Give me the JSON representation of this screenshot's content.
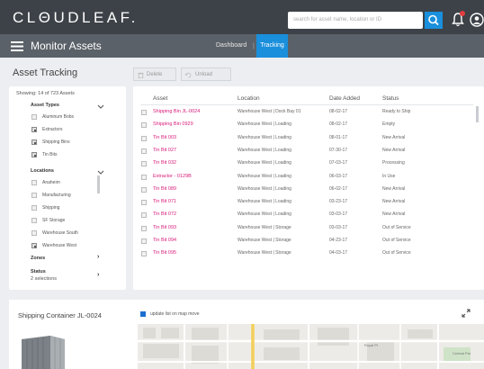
{
  "header": {
    "logo": "CLΘUDLEAF.",
    "search_placeholder": "search for asset name, location or ID"
  },
  "subheader": {
    "title": "Monitor Assets",
    "tabs": [
      {
        "label": "Dashboard",
        "active": false
      },
      {
        "label": "Tracking",
        "active": true
      }
    ],
    "separator": "|"
  },
  "page": {
    "title": "Asset Tracking",
    "delete_label": "Delete",
    "unload_label": "Unload"
  },
  "filters": {
    "showing": "Showing: 14 of 723 Assets",
    "asset_types": {
      "title": "Asset Types",
      "items": [
        {
          "label": "Aluminum Bobs",
          "checked": false
        },
        {
          "label": "Extractors",
          "checked": true
        },
        {
          "label": "Shipping Bins",
          "checked": true
        },
        {
          "label": "Tin Bits",
          "checked": true
        }
      ]
    },
    "locations": {
      "title": "Locations",
      "items": [
        {
          "label": "Anaheim",
          "checked": false
        },
        {
          "label": "Manufacturing",
          "checked": false
        },
        {
          "label": "Shipping",
          "checked": false
        },
        {
          "label": "SF Storage",
          "checked": false
        },
        {
          "label": "Warehouse South",
          "checked": false
        },
        {
          "label": "Warehouse West",
          "checked": true
        }
      ]
    },
    "zones": {
      "title": "Zones",
      "chevron": "›"
    },
    "status": {
      "title": "Status",
      "subtitle": "2 selections",
      "chevron": "›"
    }
  },
  "table": {
    "columns": [
      "Asset",
      "Location",
      "Date Added",
      "Status"
    ],
    "rows": [
      {
        "asset": "Shipping Bin JL-0024",
        "location": "Warehouse West | Dock Bay 01",
        "date": "08-02-17",
        "status": "Ready to Ship"
      },
      {
        "asset": "Shipping Bin 0929",
        "location": "Warehouse West | Loading",
        "date": "08-02-17",
        "status": "Empty"
      },
      {
        "asset": "Tin Bit 003",
        "location": "Warehouse West | Loading",
        "date": "08-01-17",
        "status": "New Arrival"
      },
      {
        "asset": "Tin Bit 027",
        "location": "Warehouse West | Loading",
        "date": "07-30-17",
        "status": "New Arrival"
      },
      {
        "asset": "Tin Bit 032",
        "location": "Warehouse West | Loading",
        "date": "07-03-17",
        "status": "Processing"
      },
      {
        "asset": "Extractor - 0129B",
        "location": "Warehouse West | Loading",
        "date": "06-03-17",
        "status": "In Use"
      },
      {
        "asset": "Tin Bit 089",
        "location": "Warehouse West | Loading",
        "date": "06-02-17",
        "status": "New Arrival"
      },
      {
        "asset": "Tin Bit 071",
        "location": "Warehouse West | Loading",
        "date": "03-23-17",
        "status": "New Arrival"
      },
      {
        "asset": "Tin Bit 072",
        "location": "Warehouse West | Loading",
        "date": "03-03-17",
        "status": "New Arrival"
      },
      {
        "asset": "Tin Bit 093",
        "location": "Warehouse West | Storage",
        "date": "03-03-17",
        "status": "Out of Service"
      },
      {
        "asset": "Tin Bit 094",
        "location": "Warehouse West | Storage",
        "date": "04-23-17",
        "status": "Out of Service"
      },
      {
        "asset": "Tin Bit 095",
        "location": "Warehouse West | Storage",
        "date": "04-03-17",
        "status": "Out of Service"
      }
    ]
  },
  "detail": {
    "title": "Shipping Container JL-0024",
    "update_label": "update list on map move",
    "map_labels": [
      "Royal Pl",
      "Central Par"
    ]
  },
  "colors": {
    "topbar": "#3d4248",
    "subbar": "#5b6168",
    "accent": "#1a8fdc",
    "asset_link": "#d81b7a",
    "notification": "#e33c3c"
  }
}
